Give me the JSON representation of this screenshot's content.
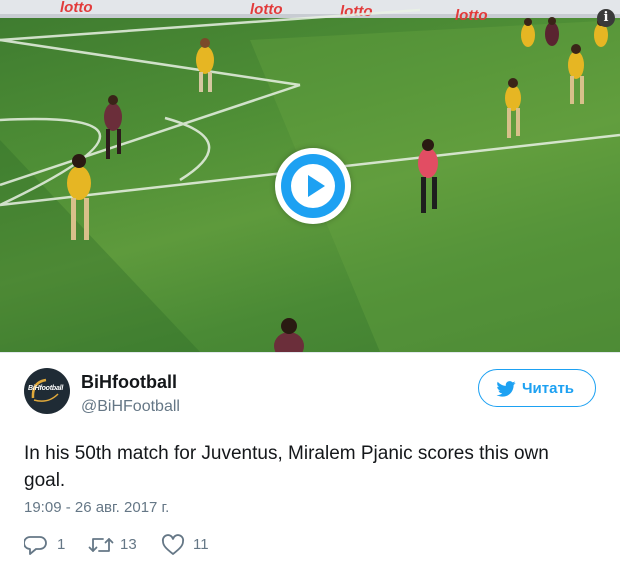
{
  "video": {
    "play_icon": "play-icon",
    "info_icon": "info-icon",
    "info_glyph": "i",
    "board_text": "lotto"
  },
  "user": {
    "avatar_text": "BiHfootball",
    "name": "BiHfootball",
    "handle": "@BiHFootball"
  },
  "follow": {
    "label": "Читать",
    "icon": "twitter-bird-icon",
    "color": "#1da1f2"
  },
  "tweet": {
    "text": "In his 50th match for Juventus, Miralem Pjanic scores this own goal.",
    "timestamp": "19:09 - 26 авг. 2017 г."
  },
  "actions": {
    "reply_count": "1",
    "retweet_count": "13",
    "like_count": "11"
  }
}
